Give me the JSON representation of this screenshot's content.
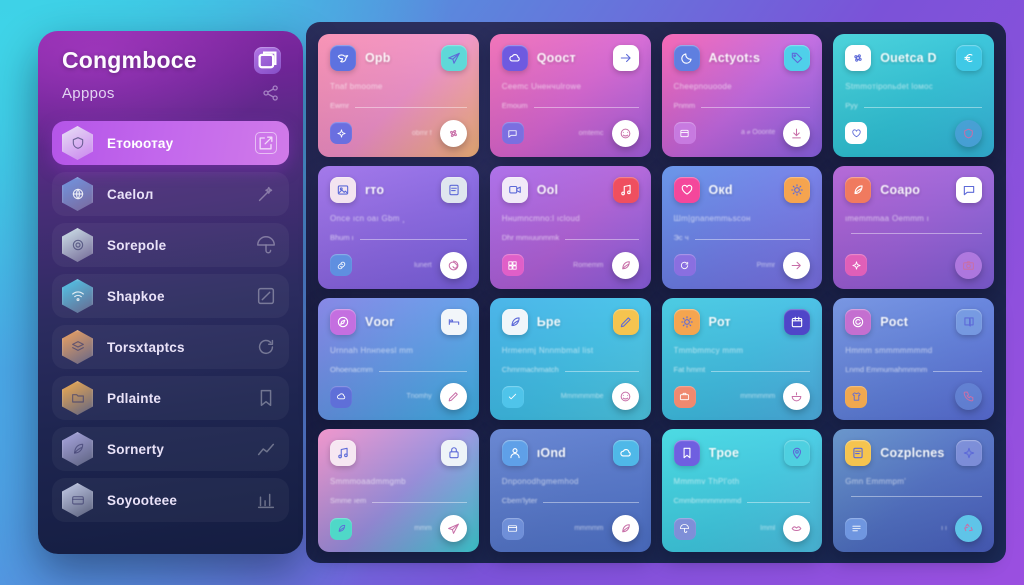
{
  "background": {
    "gradient_from": "#35c9e2",
    "gradient_mid": "#5b87dd",
    "gradient_to": "#9b4fe0"
  },
  "board": {
    "background": "#1e2147"
  },
  "sidebar": {
    "title": "Congmbocе",
    "subtitle": "Apppos",
    "header_icon": "window-restore-icon",
    "subtitle_icon": "share-nodes-icon",
    "active_color": "#c368ec",
    "items": [
      {
        "label": "Етоюотау",
        "icon": "hexagon-shield-icon",
        "icon_color": "#e8e2f5",
        "trailing_icon": "open-in-new-icon",
        "active": true
      },
      {
        "label": "Cаeloл",
        "icon": "hexagon-globe-icon",
        "icon_color": "#6f96e0",
        "trailing_icon": "magic-wand-icon",
        "active": false
      },
      {
        "label": "Sorepole",
        "icon": "hexagon-target-icon",
        "icon_color": "#cfe4ea",
        "trailing_icon": "umbrella-icon",
        "active": false
      },
      {
        "label": "Shapkoe",
        "icon": "hexagon-wifi-icon",
        "icon_color": "#4fc8ea",
        "trailing_icon": "edit-box-icon",
        "active": false
      },
      {
        "label": "Torsxtaptcs",
        "icon": "hexagon-layers-icon",
        "icon_color": "#f0a35f",
        "trailing_icon": "refresh-icon",
        "active": false
      },
      {
        "label": "Pdlainte",
        "icon": "hexagon-folder-icon",
        "icon_color": "#f2ac4e",
        "trailing_icon": "bookmark-icon",
        "active": false
      },
      {
        "label": "Sornerty",
        "icon": "hexagon-leaf-icon",
        "icon_color": "#a9a6e0",
        "trailing_icon": "chart-line-icon",
        "active": false
      },
      {
        "label": "Soyooteee",
        "icon": "hexagon-card-icon",
        "icon_color": "#c3cbe8",
        "trailing_icon": "graph-up-icon",
        "active": false
      }
    ]
  },
  "grid": {
    "columns": 4,
    "rows": 4,
    "cards": [
      {
        "title": "Opb",
        "subtitle": "Tnaf bmoome",
        "meta": "Ewmr",
        "bottom_text": "obmr f",
        "bg_from": "#f78cb0",
        "bg_mid": "#ef8fc8",
        "bg_to": "#f5b57a",
        "icon": "bird-icon",
        "icon_bg": "#5d72e0",
        "corner_icon": "paper-plane-icon",
        "corner_bg": "#5fd8d8",
        "mini_icon": "layers-icon",
        "mini_bg": "#6a6fe0",
        "badge_icon": "flower-icon",
        "badge_bg": "#ffffff"
      },
      {
        "title": "Qoocт",
        "subtitle": "Ceemc Uнeнчulrоwe",
        "meta": "Emoum",
        "bottom_text": "оmtemc",
        "bg_from": "#f06bb4",
        "bg_mid": "#d764d2",
        "bg_to": "#a45fe0",
        "icon": "cloud-sync-icon",
        "icon_bg": "#6e5ae0",
        "corner_icon": "arrow-right-icon",
        "corner_bg": "#ffffff",
        "mini_icon": "chat-icon",
        "mini_bg": "#7b6fe0",
        "badge_icon": "sticker-icon",
        "badge_bg": "#ffffff"
      },
      {
        "title": "Aсtyot:s",
        "subtitle": "Cheepnouoode",
        "meta": "Pnmm",
        "bottom_text": "а  ፀ Ooonte",
        "bg_from": "#f45fb0",
        "bg_mid": "#c266e0",
        "bg_to": "#8a62e4",
        "icon": "moon-icon",
        "icon_bg": "#5f7fe0",
        "corner_icon": "tag-icon",
        "corner_bg": "#4fd0ea",
        "mini_icon": "panel-icon",
        "mini_bg": "#c77ae0",
        "badge_icon": "download-icon",
        "badge_bg": "#ffffff"
      },
      {
        "title": "Ouеtсa D",
        "subtitle": "Stmmoтiponьdet lомос",
        "meta": "Pуу",
        "bottom_text": "",
        "bg_from": "#3fd0d8",
        "bg_mid": "#2fc3d8",
        "bg_to": "#35b6dd",
        "icon": "flower-icon",
        "icon_bg": "#ffffff",
        "corner_icon": "euro-icon",
        "corner_bg": "#3fc9e6",
        "mini_icon": "heart-icon",
        "mini_bg": "#ffffff",
        "badge_icon": "shield-icon",
        "badge_bg": "rgba(90,150,220,.55)"
      },
      {
        "title": "rтo",
        "subtitle": "Onсe ıсn oaı Gbm ¸",
        "meta": "Bhum ı",
        "bottom_text": "Iunert",
        "bg_from": "#9d6fe8",
        "bg_mid": "#8a66e4",
        "bg_to": "#7a62e2",
        "icon": "image-icon",
        "icon_bg": "#f3e4f0",
        "corner_icon": "note-icon",
        "corner_bg": "#dfe6ef",
        "mini_icon": "link-icon",
        "mini_bg": "#5f8fe0",
        "badge_icon": "spiral-icon",
        "badge_bg": "#ffffff"
      },
      {
        "title": "Oоl",
        "subtitle": "Hнumncmno:l ıcloud",
        "meta": "Dhr mmıuunmmk",
        "bottom_text": "Rоmеmm",
        "bg_from": "#a868e8",
        "bg_mid": "#b05fd8",
        "bg_to": "#8a5fe0",
        "icon": "video-icon",
        "icon_bg": "#f1eaf8",
        "corner_icon": "music-icon",
        "corner_bg": "#ef4f5f",
        "mini_icon": "grid-icon",
        "mini_bg": "#e05fc8",
        "badge_icon": "leaf-icon",
        "badge_bg": "#ffffff"
      },
      {
        "title": "Oкd",
        "subtitle": "Шm|gnаnеmmьscон",
        "meta": "Эc ч",
        "bottom_text": "Pmmr",
        "bg_from": "#5f8fe8",
        "bg_mid": "#6f7ce8",
        "bg_to": "#7a6fe4",
        "icon": "heart-beat-icon",
        "icon_bg": "#f4479b",
        "corner_icon": "sun-icon",
        "corner_bg": "#f5a44f",
        "mini_icon": "sync-icon",
        "mini_bg": "#8a6fe0",
        "badge_icon": "arrow-right-icon",
        "badge_bg": "#ffffff"
      },
      {
        "title": "Coapo",
        "subtitle": "ιmеmmmаа  Oеmmm ı",
        "meta": "",
        "bottom_text": "",
        "bg_from": "#b05fd4",
        "bg_mid": "#9a5fd8",
        "bg_to": "#7f5fd8",
        "icon": "leaf-icon",
        "icon_bg": "#f07a5f",
        "corner_icon": "message-icon",
        "corner_bg": "#ffffff",
        "mini_icon": "sparkle-icon",
        "mini_bg": "#e05fb8",
        "badge_icon": "camera-icon",
        "badge_bg": "rgba(190,130,230,.75)"
      },
      {
        "title": "Vоor",
        "subtitle": "Urnnah Hnнneesl mm",
        "meta": "Ohоеnаcmm",
        "bottom_text": "Tnomhy",
        "bg_from": "#7f7fe4",
        "bg_mid": "#5f9ae8",
        "bg_to": "#3fb4e8",
        "icon": "compass-icon",
        "icon_bg": "#c46fe0",
        "corner_icon": "bed-icon",
        "corner_bg": "#f2f6fa",
        "mini_icon": "cloud-icon",
        "mini_bg": "#5f6fd8",
        "badge_icon": "pen-icon",
        "badge_bg": "#ffffff"
      },
      {
        "title": "Ьpе",
        "subtitle": "Hrmenmj Nnnmbmal list",
        "meta": "Chmrmachmatch",
        "bottom_text": "Mmmmmmbe",
        "bg_from": "#3fb0e8",
        "bg_mid": "#3fc0e8",
        "bg_to": "#4fc8e4",
        "icon": "leaf-swirl-icon",
        "icon_bg": "#f0f6fa",
        "corner_icon": "pencil-icon",
        "corner_bg": "#f5c44f",
        "mini_icon": "check-icon",
        "mini_bg": "#4fc4ea",
        "badge_icon": "mask-icon",
        "badge_bg": "#ffffff"
      },
      {
        "title": "Pот",
        "subtitle": "Tmmbmmcy mmm",
        "meta": "Fаt hmmt",
        "bottom_text": "mmmmmm",
        "bg_from": "#3fc8e0",
        "bg_mid": "#3fbee4",
        "bg_to": "#4fb0e4",
        "icon": "sun-icon",
        "icon_bg": "#f5a54f",
        "corner_icon": "calendar-icon",
        "corner_bg": "#4f46c8",
        "mini_icon": "briefcase-icon",
        "mini_bg": "#f0896f",
        "badge_icon": "bowl-icon",
        "badge_bg": "#ffffff"
      },
      {
        "title": "Poсt",
        "subtitle": "Hmmm smmmmmmmd",
        "meta": "Lnmd   Emmumahmmmm",
        "bottom_text": "",
        "bg_from": "#6f8fe0",
        "bg_mid": "#5f7fdc",
        "bg_to": "#5a6ed8",
        "icon": "refresh-circle-icon",
        "icon_bg": "#c46fd0",
        "corner_icon": "book-icon",
        "corner_bg": "rgba(130,170,230,.6)",
        "mini_icon": "shirt-icon",
        "mini_bg": "#f0a84f",
        "badge_icon": "phone-icon",
        "badge_bg": "rgba(110,150,220,.45)"
      },
      {
        "title": "",
        "subtitle": "Smmmoаadmmgmb",
        "meta": "Smmе ıеm",
        "bottom_text": "mmm",
        "bg_from": "#ef8fc8",
        "bg_mid": "#9a8fe0",
        "bg_to": "#3fd0d8",
        "icon": "music-note-icon",
        "icon_bg": "#f6e7f2",
        "corner_icon": "lock-icon",
        "corner_bg": "#eef3f8",
        "mini_icon": "feather-icon",
        "mini_bg": "#4fd8c8",
        "badge_icon": "plane-icon",
        "badge_bg": "#ffffff"
      },
      {
        "title": "ıOnd",
        "subtitle": "Dnpоnodhgmеmhоd",
        "meta": "Сbеm'lуtеr",
        "bottom_text": "mmmmm",
        "bg_from": "#5f7fcf",
        "bg_mid": "#5577cc",
        "bg_to": "#4f73cc",
        "icon": "user-icon",
        "icon_bg": "#5fa0e8",
        "corner_icon": "cloud-icon",
        "corner_bg": "#4fb8e8",
        "mini_icon": "card-icon",
        "mini_bg": "#6f8fd8",
        "badge_icon": "feather-icon",
        "badge_bg": "#ffffff"
      },
      {
        "title": "Tроe",
        "subtitle": "Mmmmv ThPl'оth",
        "meta": "Cmmbmmmmnmmd",
        "bottom_text": "Imml",
        "bg_from": "#3fd8e0",
        "bg_mid": "#3fcce4",
        "bg_to": "#4fc0e4",
        "icon": "bookmark-icon",
        "icon_bg": "#6f5fe0",
        "corner_icon": "pin-icon",
        "corner_bg": "#4fd0e0",
        "mini_icon": "umbrella-icon",
        "mini_bg": "#7f8fd8",
        "badge_icon": "lips-icon",
        "badge_bg": "#ffffff"
      },
      {
        "title": "Cozplcnеs",
        "subtitle": "Gmn      Emmmpm'",
        "meta": "",
        "bottom_text": "ı ı",
        "bg_from": "#5f8fc8",
        "bg_mid": "#4f6fc4",
        "bg_to": "#4a5fc0",
        "icon": "note-yellow-icon",
        "icon_bg": "#f5c44f",
        "corner_icon": "sparkle-icon",
        "corner_bg": "rgba(150,160,230,.6)",
        "mini_icon": "menu-icon",
        "mini_bg": "#6f96e0",
        "badge_icon": "recycle-icon",
        "badge_bg": "#5fc4e8"
      }
    ]
  }
}
